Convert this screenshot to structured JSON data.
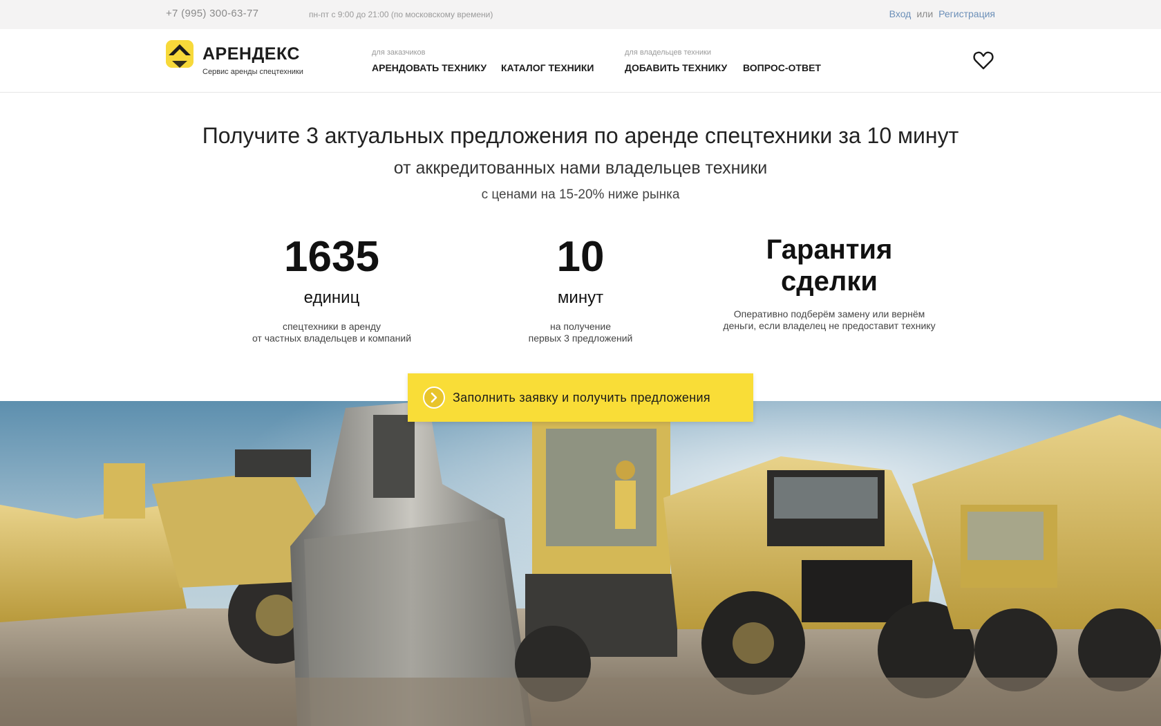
{
  "topbar": {
    "phone": "+7 (995) 300-63-77",
    "hours": "пн-пт с 9:00 до 21:00 (по московскому времени)",
    "login": "Вход",
    "or": "или",
    "register": "Регистрация"
  },
  "logo": {
    "name": "АРЕНДЕКС",
    "tagline": "Сервис аренды спецтехники"
  },
  "nav": {
    "customers_caption": "для заказчиков",
    "rent": "АРЕНДОВАТЬ ТЕХНИКУ",
    "catalog": "КАТАЛОГ ТЕХНИКИ",
    "owners_caption": "для владельцев техники",
    "add": "ДОБАВИТЬ ТЕХНИКУ",
    "faq": "ВОПРОС-ОТВЕТ",
    "favorites_icon": "heart-icon"
  },
  "hero": {
    "title": "Получите 3 актуальных предложения по аренде спецтехники за 10 минут",
    "subtitle": "от аккредитованных нами владельцев техники",
    "note": "с ценами на 15-20% ниже рынка",
    "stats": [
      {
        "value": "1635",
        "unit": "единиц",
        "desc1": "спецтехники в аренду",
        "desc2": "от частных владельцев и компаний"
      },
      {
        "value": "10",
        "unit": "минут",
        "desc1": "на получение",
        "desc2": "первых 3 предложений"
      },
      {
        "line1": "Гарантия",
        "line2": "сделки",
        "desc1": "Оперативно подберём замену или вернём",
        "desc2": "деньги, если владелец не предоставит технику"
      }
    ],
    "cta_label": "Заполнить заявку и получить предложения"
  },
  "colors": {
    "brand_yellow": "#f9dd37",
    "link_blue": "#6b8fb8",
    "topbar_bg": "#f4f3f3"
  }
}
